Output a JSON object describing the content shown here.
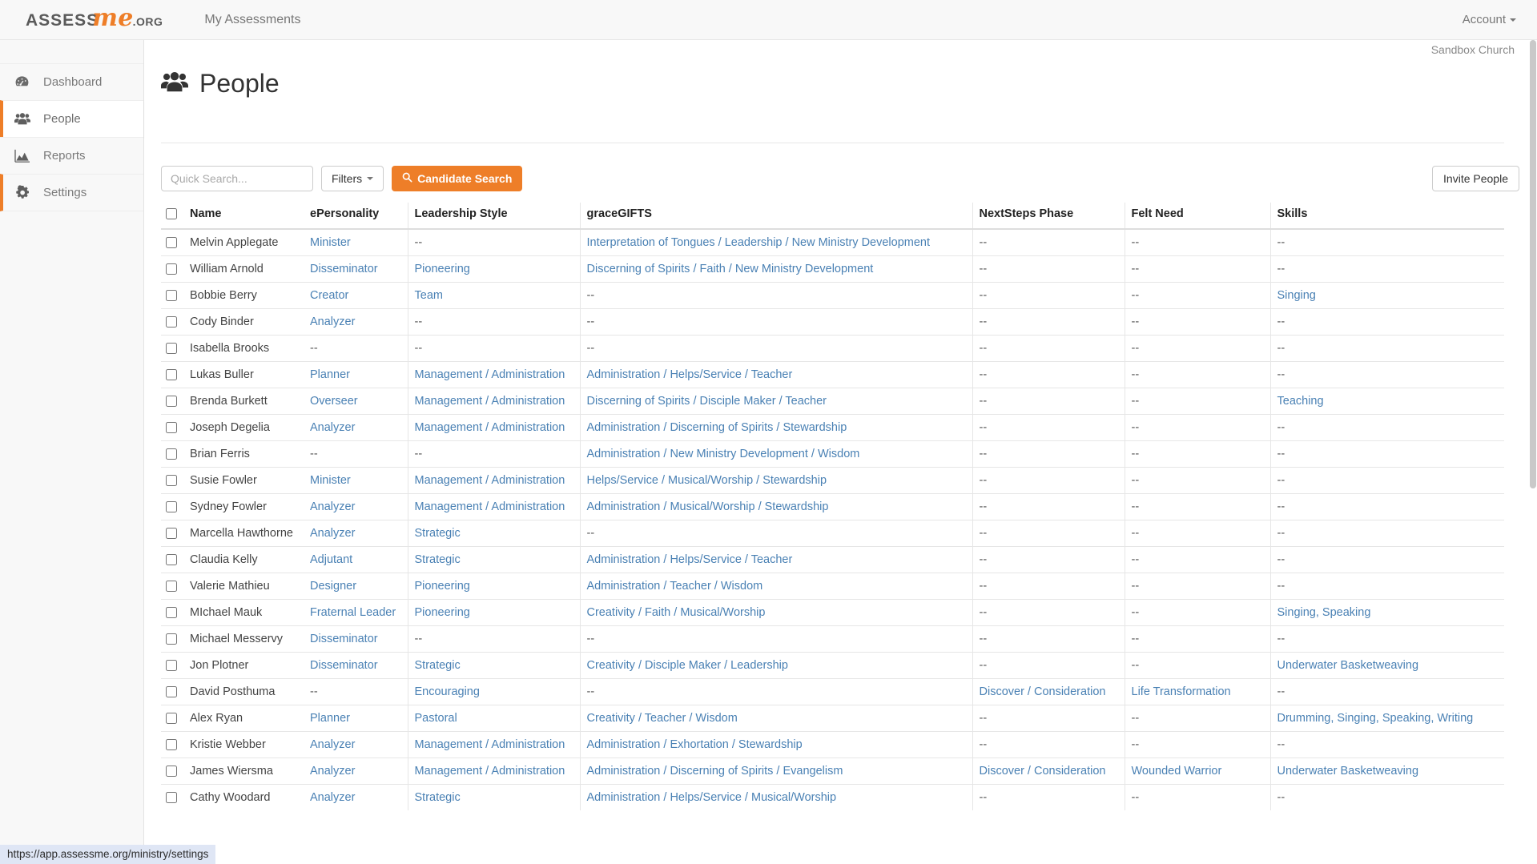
{
  "navbar": {
    "brand": {
      "part1": "ASSESS",
      "part2": "me",
      "part3": ".ORG"
    },
    "my_assessments": "My Assessments",
    "account": "Account"
  },
  "sidebar": {
    "items": [
      {
        "label": "Dashboard",
        "icon": "dashboard-icon",
        "state": "default"
      },
      {
        "label": "People",
        "icon": "people-icon",
        "state": "active"
      },
      {
        "label": "Reports",
        "icon": "reports-icon",
        "state": "default"
      },
      {
        "label": "Settings",
        "icon": "settings-icon",
        "state": "hover"
      }
    ]
  },
  "header": {
    "church": "Sandbox Church",
    "page_title": "People"
  },
  "toolbar": {
    "search_placeholder": "Quick Search...",
    "search_value": "",
    "filters_label": "Filters",
    "candidate_search_label": "Candidate Search",
    "invite_people_label": "Invite People"
  },
  "table": {
    "columns": [
      "Name",
      "ePersonality",
      "Leadership Style",
      "graceGIFTS",
      "NextSteps Phase",
      "Felt Need",
      "Skills"
    ],
    "rows": [
      {
        "name": "Melvin Applegate",
        "epersonality": "Minister",
        "leadership": "--",
        "gracegifts": "Interpretation of Tongues / Leadership / New Ministry Development",
        "nextsteps": "--",
        "feltneed": "--",
        "skills": "--"
      },
      {
        "name": "William Arnold",
        "epersonality": "Disseminator",
        "leadership": "Pioneering",
        "gracegifts": "Discerning of Spirits / Faith / New Ministry Development",
        "nextsteps": "--",
        "feltneed": "--",
        "skills": "--"
      },
      {
        "name": "Bobbie Berry",
        "epersonality": "Creator",
        "leadership": "Team",
        "gracegifts": "--",
        "nextsteps": "--",
        "feltneed": "--",
        "skills": "Singing"
      },
      {
        "name": "Cody Binder",
        "epersonality": "Analyzer",
        "leadership": "--",
        "gracegifts": "--",
        "nextsteps": "--",
        "feltneed": "--",
        "skills": "--"
      },
      {
        "name": "Isabella Brooks",
        "epersonality": "--",
        "leadership": "--",
        "gracegifts": "--",
        "nextsteps": "--",
        "feltneed": "--",
        "skills": "--"
      },
      {
        "name": "Lukas Buller",
        "epersonality": "Planner",
        "leadership": "Management / Administration",
        "gracegifts": "Administration / Helps/Service / Teacher",
        "nextsteps": "--",
        "feltneed": "--",
        "skills": "--"
      },
      {
        "name": "Brenda Burkett",
        "epersonality": "Overseer",
        "leadership": "Management / Administration",
        "gracegifts": "Discerning of Spirits / Disciple Maker / Teacher",
        "nextsteps": "--",
        "feltneed": "--",
        "skills": "Teaching"
      },
      {
        "name": "Joseph Degelia",
        "epersonality": "Analyzer",
        "leadership": "Management / Administration",
        "gracegifts": "Administration / Discerning of Spirits / Stewardship",
        "nextsteps": "--",
        "feltneed": "--",
        "skills": "--"
      },
      {
        "name": "Brian Ferris",
        "epersonality": "--",
        "leadership": "--",
        "gracegifts": "Administration / New Ministry Development / Wisdom",
        "nextsteps": "--",
        "feltneed": "--",
        "skills": "--"
      },
      {
        "name": "Susie Fowler",
        "epersonality": "Minister",
        "leadership": "Management / Administration",
        "gracegifts": "Helps/Service / Musical/Worship / Stewardship",
        "nextsteps": "--",
        "feltneed": "--",
        "skills": "--"
      },
      {
        "name": "Sydney Fowler",
        "epersonality": "Analyzer",
        "leadership": "Management / Administration",
        "gracegifts": "Administration / Musical/Worship / Stewardship",
        "nextsteps": "--",
        "feltneed": "--",
        "skills": "--"
      },
      {
        "name": "Marcella Hawthorne",
        "epersonality": "Analyzer",
        "leadership": "Strategic",
        "gracegifts": "--",
        "nextsteps": "--",
        "feltneed": "--",
        "skills": "--"
      },
      {
        "name": "Claudia Kelly",
        "epersonality": "Adjutant",
        "leadership": "Strategic",
        "gracegifts": "Administration / Helps/Service / Teacher",
        "nextsteps": "--",
        "feltneed": "--",
        "skills": "--"
      },
      {
        "name": "Valerie Mathieu",
        "epersonality": "Designer",
        "leadership": "Pioneering",
        "gracegifts": "Administration / Teacher / Wisdom",
        "nextsteps": "--",
        "feltneed": "--",
        "skills": "--"
      },
      {
        "name": "MIchael Mauk",
        "epersonality": "Fraternal Leader",
        "leadership": "Pioneering",
        "gracegifts": "Creativity / Faith / Musical/Worship",
        "nextsteps": "--",
        "feltneed": "--",
        "skills": "Singing, Speaking"
      },
      {
        "name": "Michael Messervy",
        "epersonality": "Disseminator",
        "leadership": "--",
        "gracegifts": "--",
        "nextsteps": "--",
        "feltneed": "--",
        "skills": "--"
      },
      {
        "name": "Jon Plotner",
        "epersonality": "Disseminator",
        "leadership": "Strategic",
        "gracegifts": "Creativity / Disciple Maker / Leadership",
        "nextsteps": "--",
        "feltneed": "--",
        "skills": "Underwater Basketweaving"
      },
      {
        "name": "David Posthuma",
        "epersonality": "--",
        "leadership": "Encouraging",
        "gracegifts": "--",
        "nextsteps": "Discover / Consideration",
        "feltneed": "Life Transformation",
        "skills": "--"
      },
      {
        "name": "Alex Ryan",
        "epersonality": "Planner",
        "leadership": "Pastoral",
        "gracegifts": "Creativity / Teacher / Wisdom",
        "nextsteps": "--",
        "feltneed": "--",
        "skills": "Drumming, Singing, Speaking, Writing"
      },
      {
        "name": "Kristie Webber",
        "epersonality": "Analyzer",
        "leadership": "Management / Administration",
        "gracegifts": "Administration / Exhortation / Stewardship",
        "nextsteps": "--",
        "feltneed": "--",
        "skills": "--"
      },
      {
        "name": "James Wiersma",
        "epersonality": "Analyzer",
        "leadership": "Management / Administration",
        "gracegifts": "Administration / Discerning of Spirits / Evangelism",
        "nextsteps": "Discover / Consideration",
        "feltneed": "Wounded Warrior",
        "skills": "Underwater Basketweaving"
      },
      {
        "name": "Cathy Woodard",
        "epersonality": "Analyzer",
        "leadership": "Strategic",
        "gracegifts": "Administration / Helps/Service / Musical/Worship",
        "nextsteps": "--",
        "feltneed": "--",
        "skills": "--"
      }
    ]
  },
  "status_bar": {
    "url": "https://app.assessme.org/ministry/settings"
  },
  "colors": {
    "accent": "#ee7e28",
    "link": "#4a81b4",
    "sidebar_bg": "#f8f8f8",
    "status_bg": "#dfe6f5"
  }
}
